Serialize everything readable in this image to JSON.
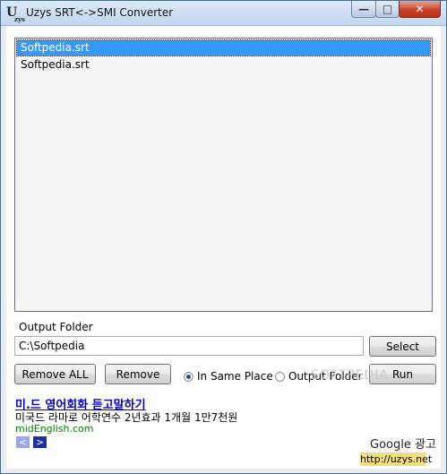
{
  "window": {
    "title": "Uzys SRT<->SMI Converter",
    "icon_text": "U",
    "icon_sub": "zys",
    "controls": {
      "minimize": "—",
      "maximize": "□",
      "close": "✕"
    }
  },
  "file_list": {
    "items": [
      {
        "label": "Softpedia.srt",
        "selected": true
      },
      {
        "label": "Softpedia.srt",
        "selected": false
      }
    ]
  },
  "output": {
    "label": "Output Folder",
    "path": "C:\\Softpedia",
    "select_label": "Select"
  },
  "actions": {
    "remove_all_label": "Remove ALL",
    "remove_label": "Remove",
    "run_label": "Run"
  },
  "radio": {
    "same_place_label": "In Same Place",
    "output_folder_label": "Output Folder",
    "selected": "same_place"
  },
  "ad": {
    "title": "미.드 영어회화 듣고말하기",
    "text": "미국드 라마로 어학연수 2년효과 1개월 1만7천원",
    "url": "midEnglish.com",
    "prev": "<",
    "next": ">",
    "google_label": "Google 광고"
  },
  "site_link": "http://uzys.net",
  "watermark": "SOFTPEDIA"
}
